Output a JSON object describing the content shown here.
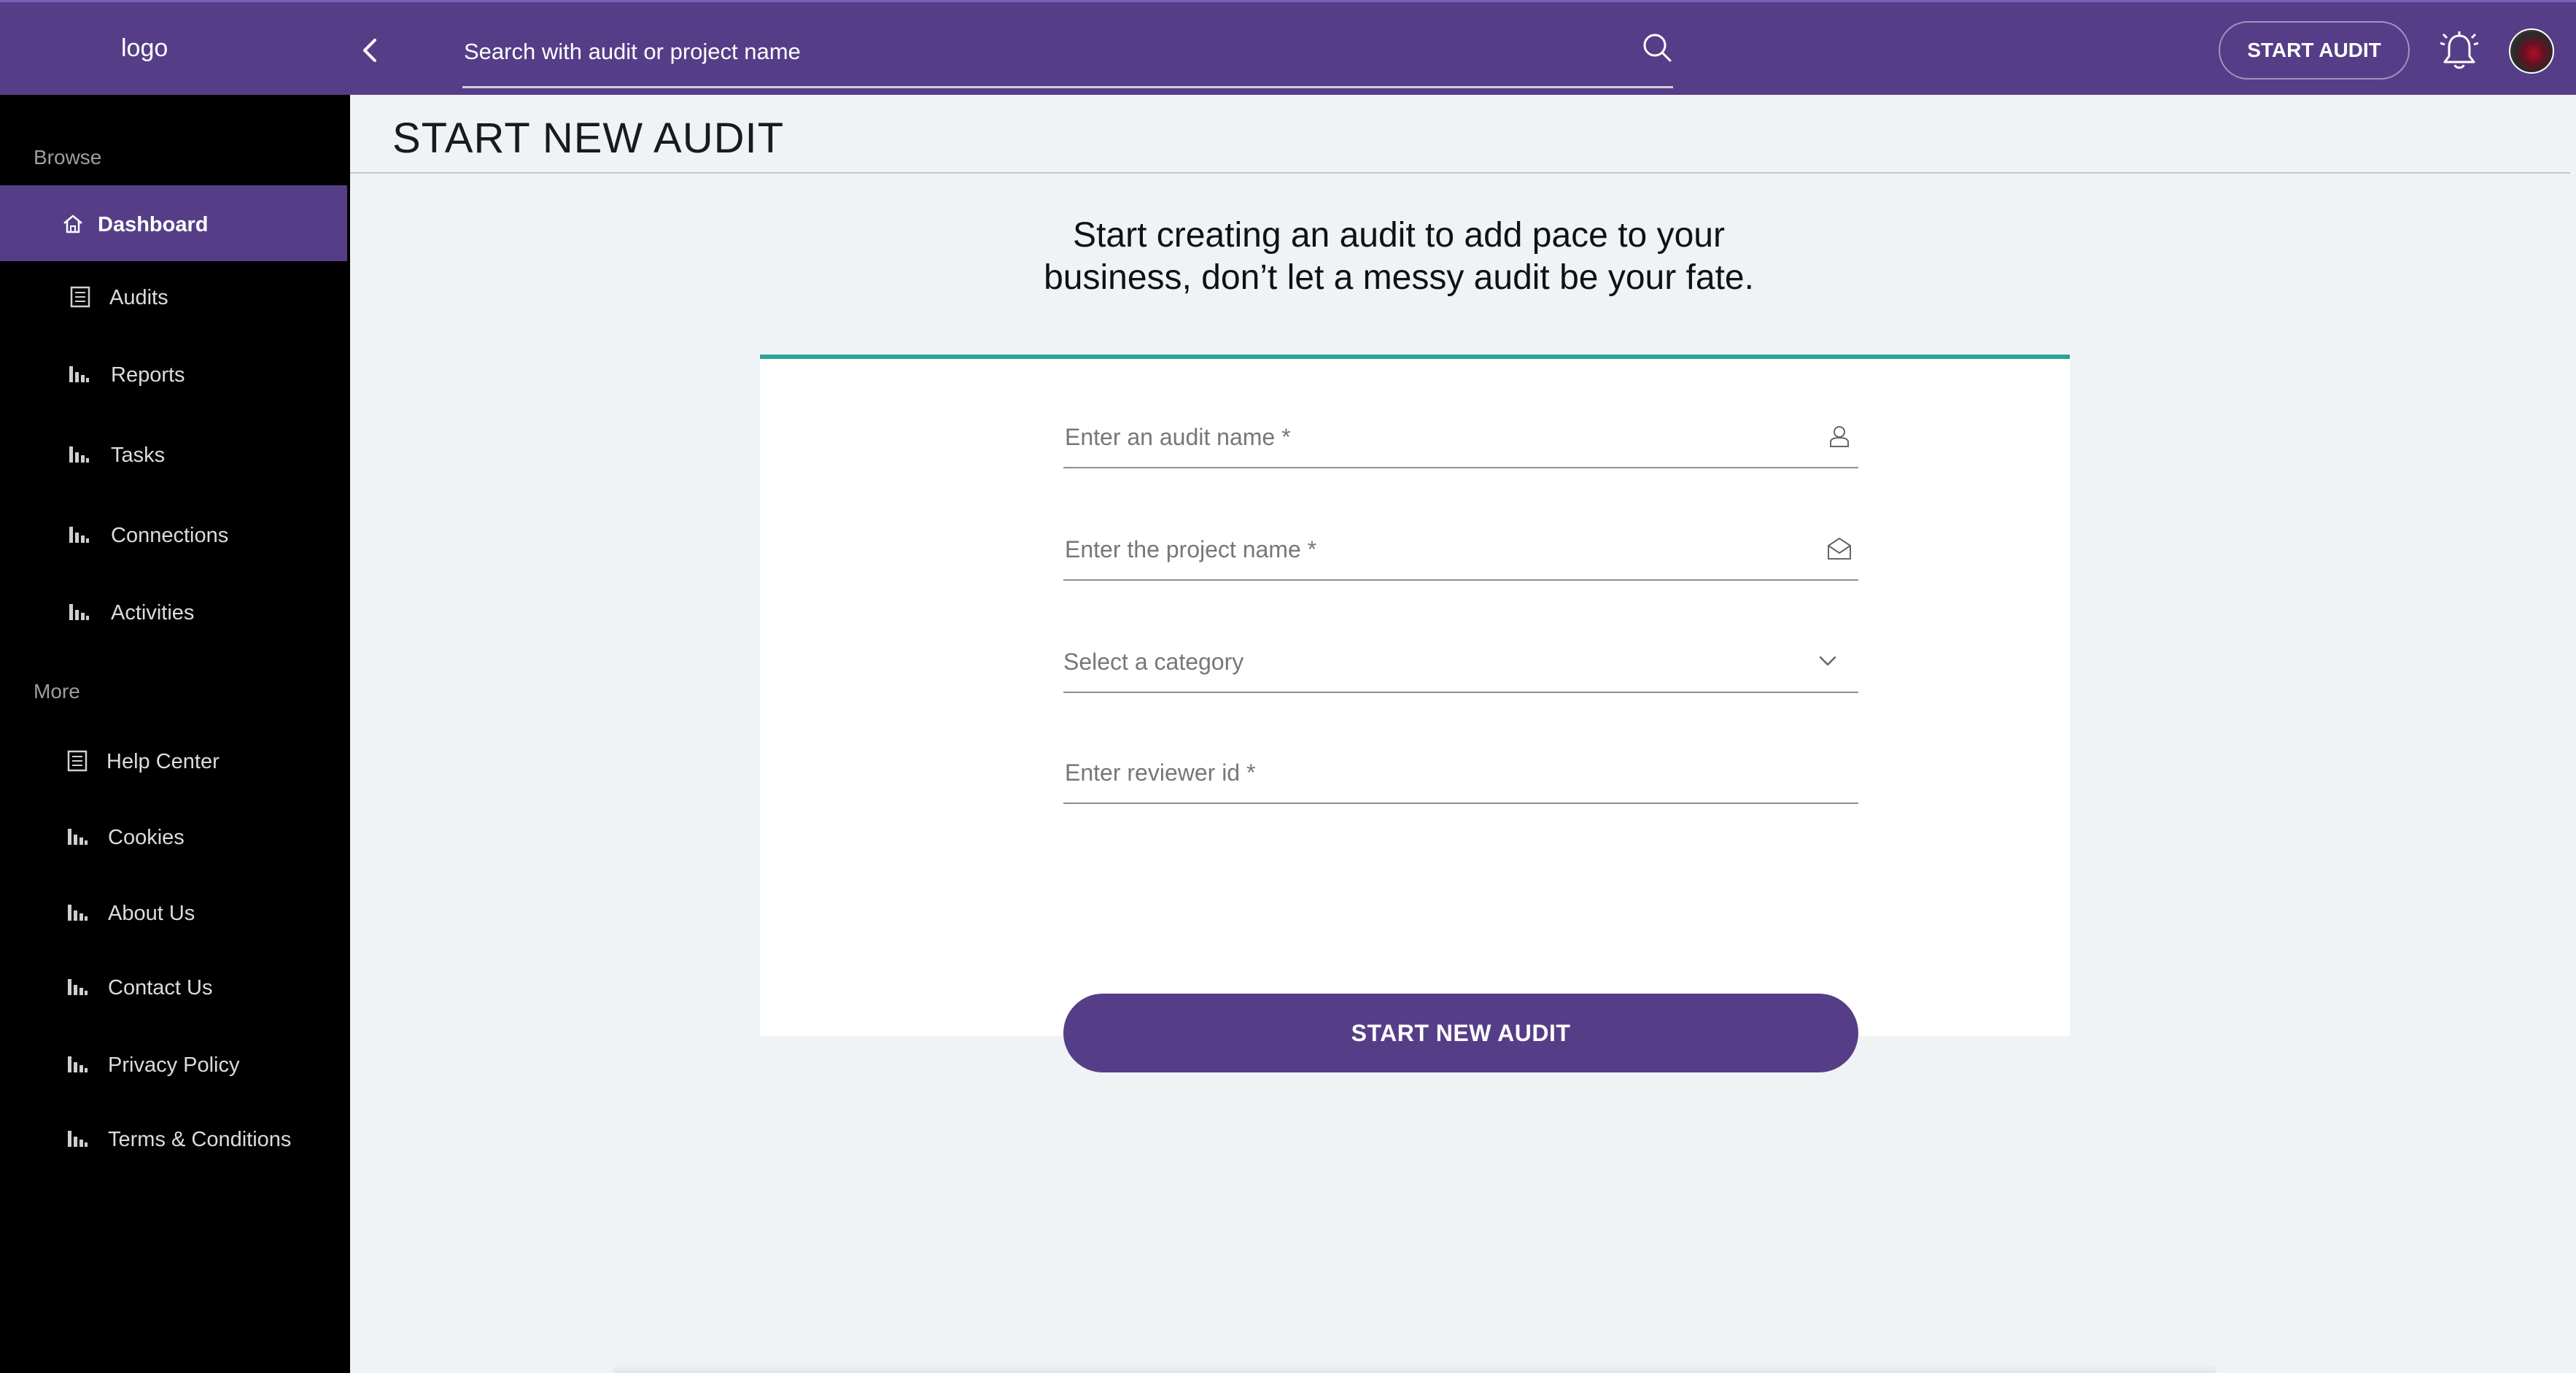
{
  "header": {
    "logo": "logo",
    "search_placeholder": "Search with audit or project name",
    "start_audit_label": "START AUDIT"
  },
  "sidebar": {
    "browse_title": "Browse",
    "more_title": "More",
    "browse_items": [
      {
        "label": "Dashboard",
        "icon": "home-icon",
        "active": true
      },
      {
        "label": "Audits",
        "icon": "document-icon"
      },
      {
        "label": "Reports",
        "icon": "bar-chart-icon"
      },
      {
        "label": "Tasks",
        "icon": "bar-chart-icon"
      },
      {
        "label": "Connections",
        "icon": "bar-chart-icon"
      },
      {
        "label": "Activities",
        "icon": "bar-chart-icon"
      }
    ],
    "more_items": [
      {
        "label": "Help Center",
        "icon": "document-icon"
      },
      {
        "label": "Cookies",
        "icon": "bar-chart-icon"
      },
      {
        "label": "About Us",
        "icon": "bar-chart-icon"
      },
      {
        "label": "Contact Us",
        "icon": "bar-chart-icon"
      },
      {
        "label": "Privacy Policy",
        "icon": "bar-chart-icon"
      },
      {
        "label": "Terms & Conditions",
        "icon": "bar-chart-icon"
      }
    ]
  },
  "main": {
    "page_title": "START NEW AUDIT",
    "tagline_line1": "Start creating an audit to add pace to your",
    "tagline_line2": "business, don’t let a messy audit be your fate.",
    "form": {
      "audit_name_placeholder": "Enter an audit name *",
      "project_name_placeholder": "Enter the project name *",
      "category_placeholder": "Select a category",
      "reviewer_placeholder": "Enter reviewer id *",
      "submit_label": "START NEW AUDIT"
    }
  },
  "colors": {
    "brand": "#553e87",
    "accent": "#2aa392",
    "sidebar_bg": "#000000",
    "page_bg": "#eff3f6"
  }
}
